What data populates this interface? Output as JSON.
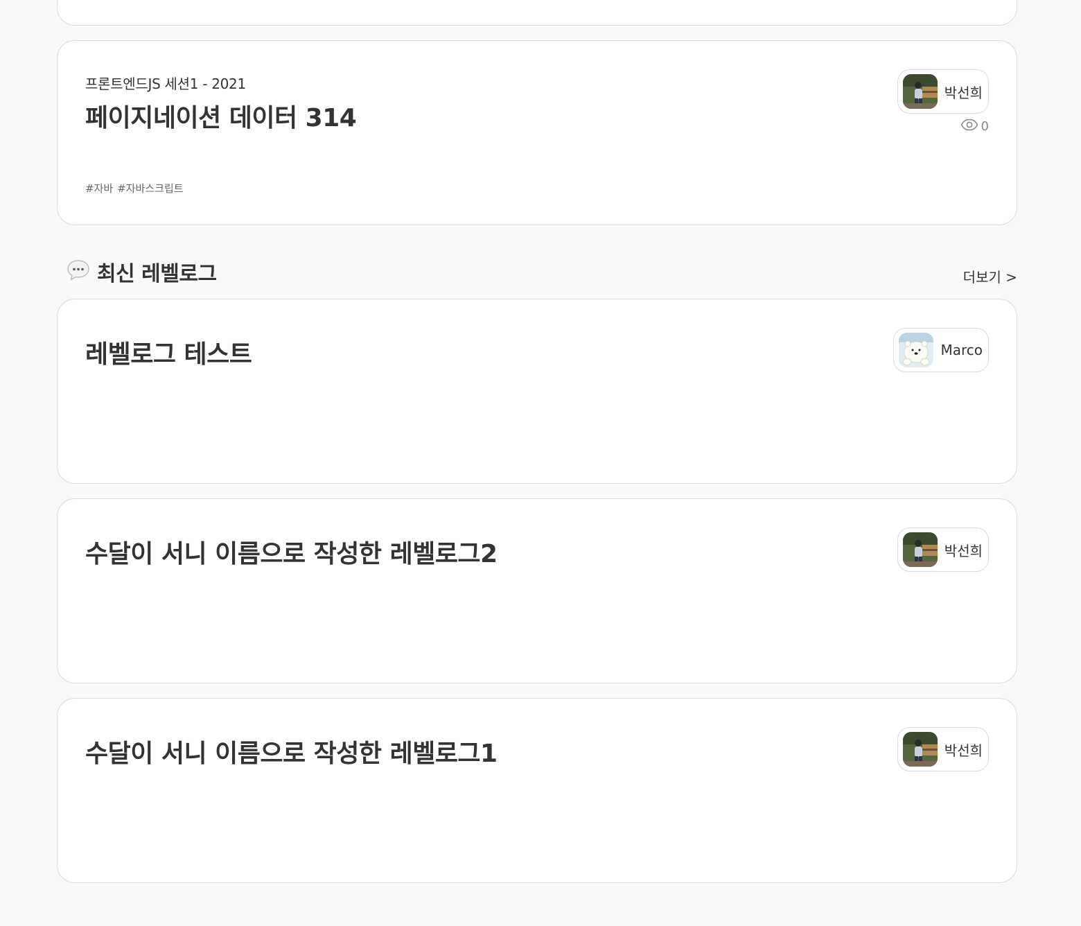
{
  "featured": {
    "session": "프론트엔드JS 세션1 - 2021",
    "title": "페이지네이션 데이터 314",
    "author": "박선희",
    "views": "0",
    "tags": [
      "#자바",
      "#자바스크립트"
    ]
  },
  "section": {
    "icon": "speech-bubble-icon",
    "title": "최신 레벨로그",
    "more_label": "더보기 >"
  },
  "levellogs": [
    {
      "title": "레벨로그 테스트",
      "author": "Marco"
    },
    {
      "title": "수달이 서니 이름으로 작성한 레벨로그2",
      "author": "박선희"
    },
    {
      "title": "수달이 서니 이름으로 작성한 레벨로그1",
      "author": "박선희"
    }
  ],
  "icons": {
    "views": "eye-icon"
  },
  "colors": {
    "background": "#f9f9f9",
    "card_border": "#dcdcdc",
    "text": "#333333",
    "muted": "#888888"
  }
}
